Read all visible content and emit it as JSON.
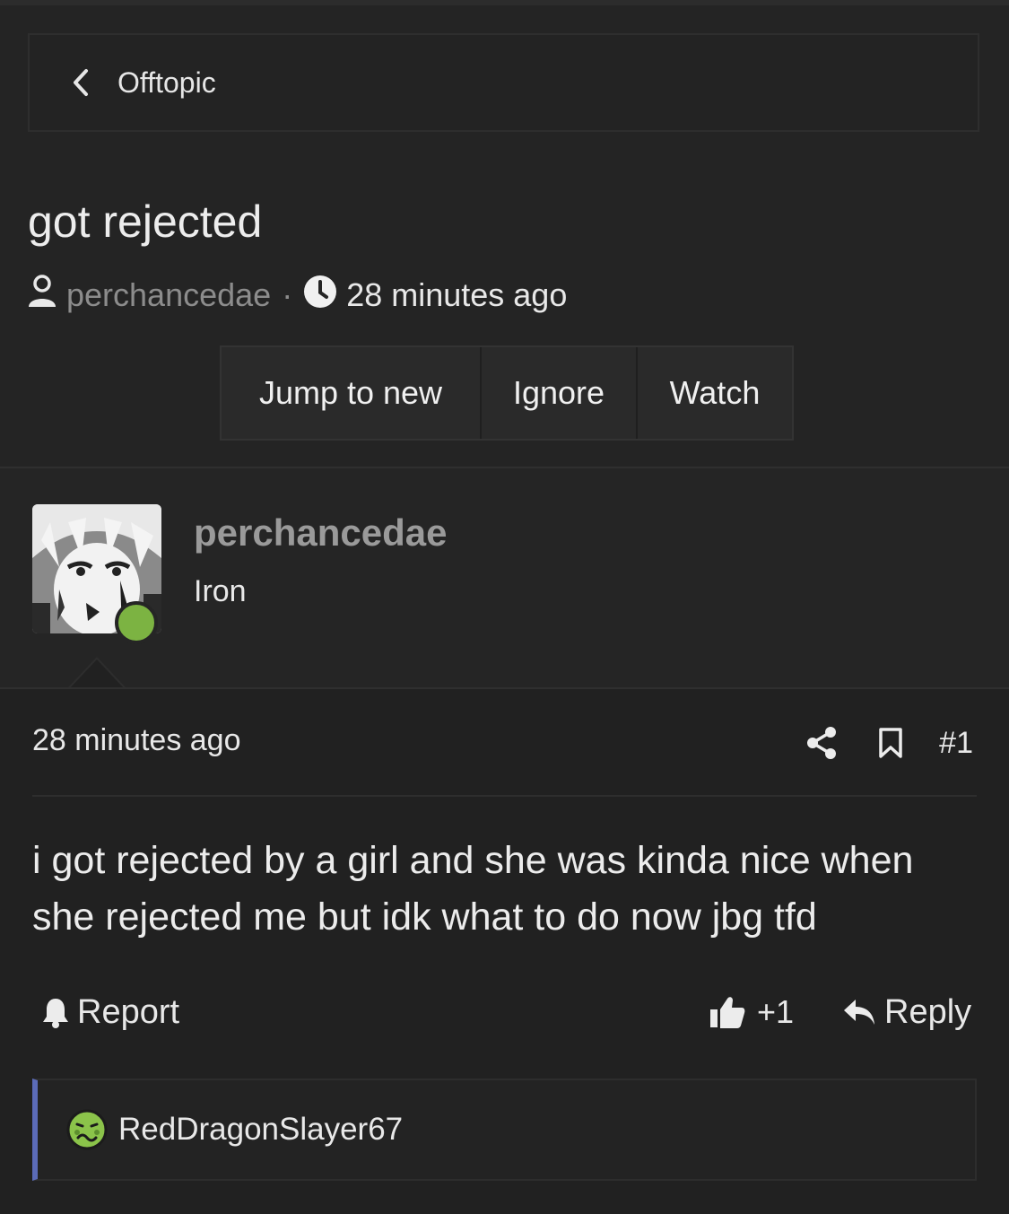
{
  "breadcrumb": {
    "label": "Offtopic"
  },
  "thread": {
    "title": "got rejected",
    "author": "perchancedae",
    "separator": "·",
    "time": "28 minutes ago"
  },
  "actions": {
    "jump": "Jump to new",
    "ignore": "Ignore",
    "watch": "Watch"
  },
  "post": {
    "author": "perchancedae",
    "rank": "Iron",
    "online": true,
    "time": "28 minutes ago",
    "number": "#1",
    "body": "i got rejected by a girl and she was kinda nice when she rejected me but idk what to do now jbg tfd",
    "report_label": "Report",
    "like_count": "+1",
    "reply_label": "Reply"
  },
  "reply_preview": {
    "username": "RedDragonSlayer67"
  },
  "colors": {
    "background": "#242424",
    "online": "#7cb342",
    "quote_accent": "#5b6bb8"
  }
}
